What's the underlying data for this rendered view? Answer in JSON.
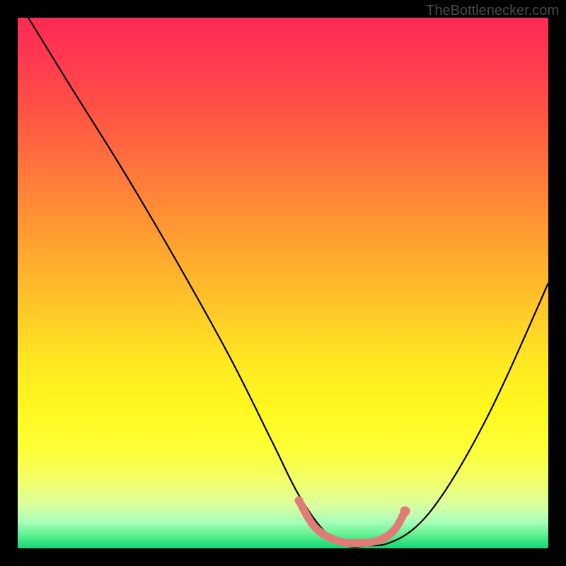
{
  "attribution": "TheBottlenecker.com",
  "chart_data": {
    "type": "line",
    "title": "",
    "xlabel": "",
    "ylabel": "",
    "xlim": [
      0,
      100
    ],
    "ylim": [
      0,
      100
    ],
    "series": [
      {
        "name": "bottleneck-curve",
        "x": [
          2,
          10,
          20,
          30,
          40,
          48,
          53,
          58,
          62,
          66,
          70,
          75,
          80,
          86,
          92,
          100
        ],
        "y": [
          100,
          87,
          71,
          54,
          36,
          20,
          10,
          3,
          0.5,
          0.5,
          1,
          4,
          10,
          20,
          32,
          50
        ]
      }
    ],
    "highlight_band": {
      "name": "optimal-range",
      "x": [
        53,
        56,
        60,
        64,
        68,
        71,
        73
      ],
      "y": [
        9,
        4,
        1.5,
        1,
        1.5,
        3.5,
        7
      ]
    },
    "colors": {
      "curve": "#000000",
      "highlight": "#e27a78",
      "bg_top": "#ff2a55",
      "bg_bottom": "#18d878"
    }
  }
}
